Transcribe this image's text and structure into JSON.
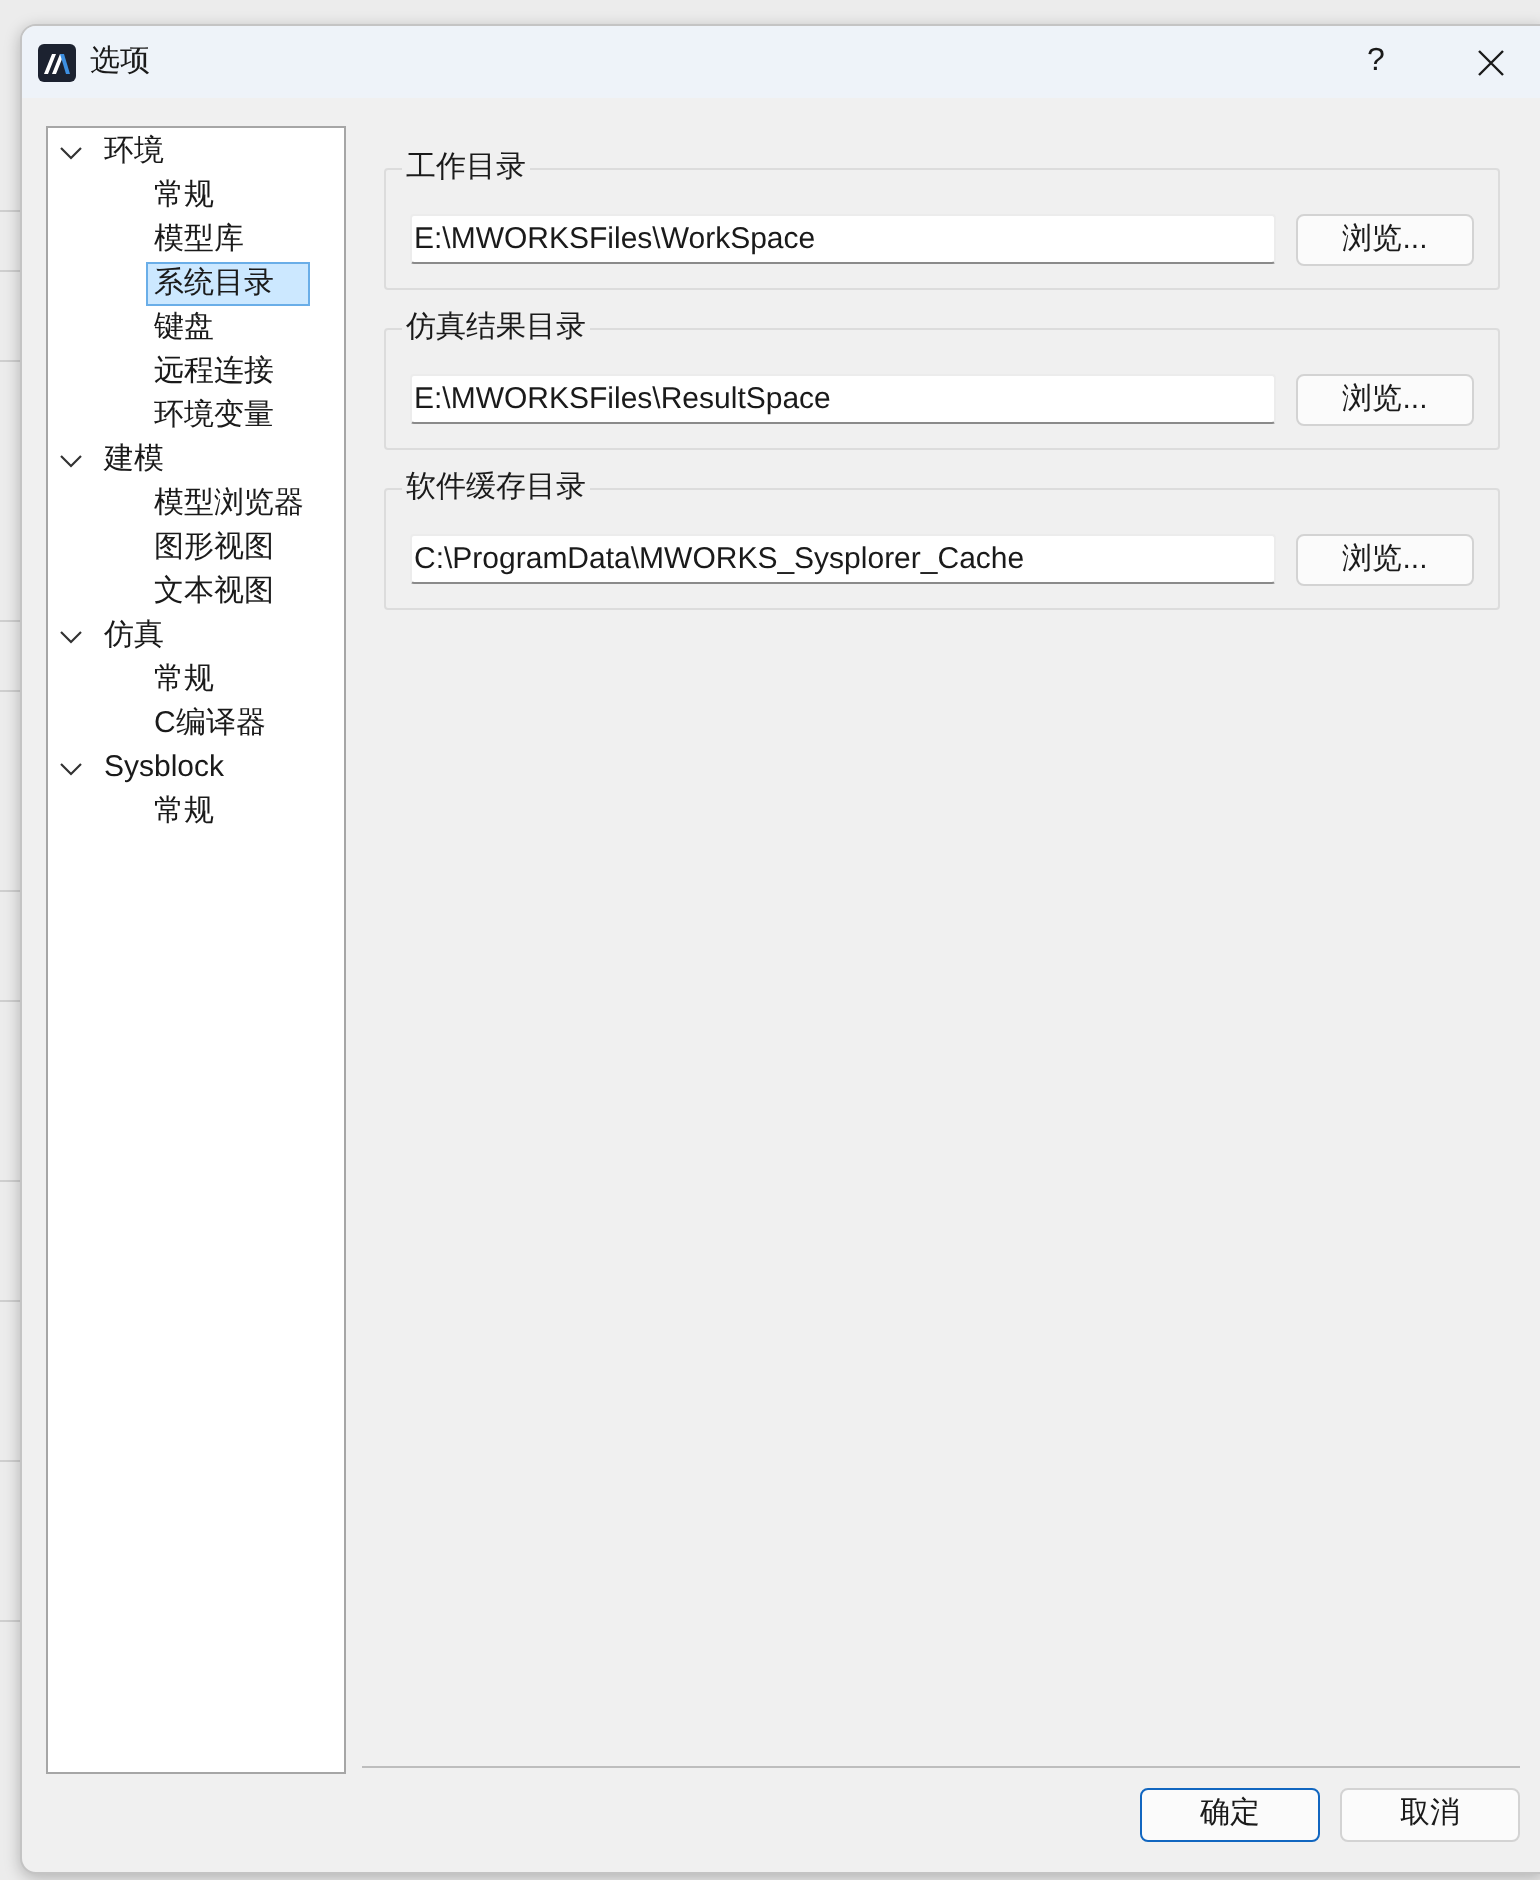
{
  "window": {
    "title": "选项",
    "help": "?"
  },
  "tree": [
    {
      "label": "环境",
      "expanded": true,
      "selected": false,
      "children": [
        {
          "label": "常规",
          "selected": false
        },
        {
          "label": "模型库",
          "selected": false
        },
        {
          "label": "系统目录",
          "selected": true
        },
        {
          "label": "键盘",
          "selected": false
        },
        {
          "label": "远程连接",
          "selected": false
        },
        {
          "label": "环境变量",
          "selected": false
        }
      ]
    },
    {
      "label": "建模",
      "expanded": true,
      "selected": false,
      "children": [
        {
          "label": "模型浏览器",
          "selected": false
        },
        {
          "label": "图形视图",
          "selected": false
        },
        {
          "label": "文本视图",
          "selected": false
        }
      ]
    },
    {
      "label": "仿真",
      "expanded": true,
      "selected": false,
      "children": [
        {
          "label": "常规",
          "selected": false
        },
        {
          "label": "C编译器",
          "selected": false
        }
      ]
    },
    {
      "label": "Sysblock",
      "expanded": true,
      "selected": false,
      "children": [
        {
          "label": "常规",
          "selected": false
        }
      ]
    }
  ],
  "groups": [
    {
      "title": "工作目录",
      "value": "E:\\MWORKSFiles\\WorkSpace",
      "button": "浏览..."
    },
    {
      "title": "仿真结果目录",
      "value": "E:\\MWORKSFiles\\ResultSpace",
      "button": "浏览..."
    },
    {
      "title": "软件缓存目录",
      "value": "C:\\ProgramData\\MWORKS_Sysplorer_Cache",
      "button": "浏览..."
    }
  ],
  "buttons": [
    {
      "label": "确定",
      "default": true
    },
    {
      "label": "取消",
      "default": false
    }
  ]
}
